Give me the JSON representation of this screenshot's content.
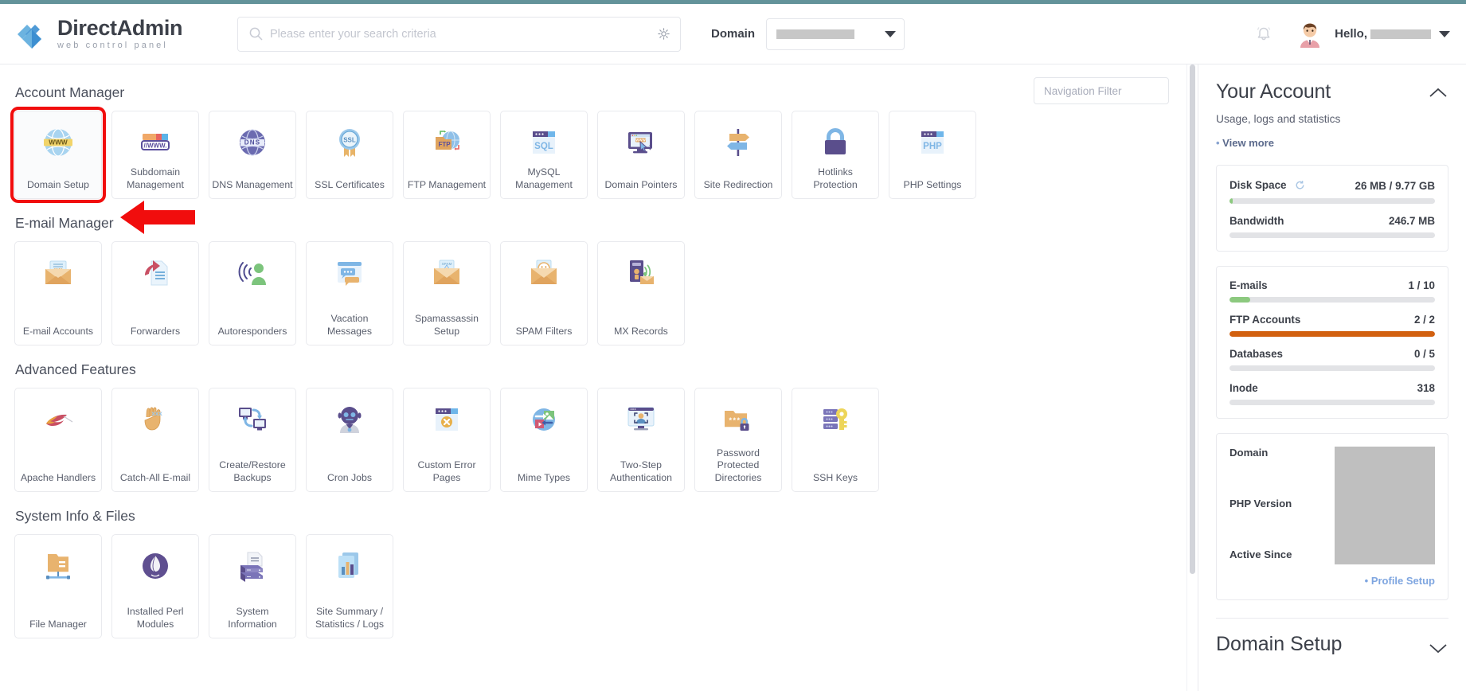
{
  "brand": {
    "name_primary": "Direct",
    "name_secondary": "Admin",
    "tagline": "web control panel"
  },
  "header": {
    "search_placeholder": "Please enter your search criteria",
    "search_value": "",
    "search_icon": "search-icon",
    "settings_icon": "gear-icon",
    "domain_label": "Domain",
    "domain_value": "",
    "bell_icon": "bell-icon",
    "avatar_icon": "user-avatar",
    "hello_label": "Hello,",
    "user_value": ""
  },
  "nav_filter": {
    "placeholder": "Navigation Filter",
    "value": ""
  },
  "sections": [
    {
      "title": "Account Manager",
      "tiles": [
        {
          "label": "Domain Setup",
          "icon": "globe-www-icon",
          "highlighted": true
        },
        {
          "label": "Subdomain Management",
          "icon": "subdomain-browser-icon",
          "highlighted": false
        },
        {
          "label": "DNS Management",
          "icon": "dns-globe-icon",
          "highlighted": false
        },
        {
          "label": "SSL Certificates",
          "icon": "ssl-badge-icon",
          "highlighted": false
        },
        {
          "label": "FTP Management",
          "icon": "ftp-folder-icon",
          "highlighted": false
        },
        {
          "label": "MySQL Management",
          "icon": "sql-window-icon",
          "highlighted": false
        },
        {
          "label": "Domain Pointers",
          "icon": "monitor-www-icon",
          "highlighted": false
        },
        {
          "label": "Site Redirection",
          "icon": "signpost-icon",
          "highlighted": false
        },
        {
          "label": "Hotlinks Protection",
          "icon": "padlock-icon",
          "highlighted": false
        },
        {
          "label": "PHP Settings",
          "icon": "php-window-icon",
          "highlighted": false
        }
      ]
    },
    {
      "title": "E-mail Manager",
      "tiles": [
        {
          "label": "E-mail Accounts",
          "icon": "envelope-password-icon",
          "highlighted": false
        },
        {
          "label": "Forwarders",
          "icon": "forward-arrow-doc-icon",
          "highlighted": false
        },
        {
          "label": "Autoresponders",
          "icon": "person-broadcast-icon",
          "highlighted": false
        },
        {
          "label": "Vacation Messages",
          "icon": "chat-window-icon",
          "highlighted": false
        },
        {
          "label": "Spamassassin Setup",
          "icon": "spam-envelope-icon",
          "highlighted": false
        },
        {
          "label": "SPAM Filters",
          "icon": "smiley-envelope-icon",
          "highlighted": false
        },
        {
          "label": "MX Records",
          "icon": "server-mail-icon",
          "highlighted": false
        }
      ]
    },
    {
      "title": "Advanced Features",
      "tiles": [
        {
          "label": "Apache Handlers",
          "icon": "feather-icon",
          "highlighted": false
        },
        {
          "label": "Catch-All E-mail",
          "icon": "catch-hand-icon",
          "highlighted": false
        },
        {
          "label": "Create/Restore Backups",
          "icon": "two-monitors-sync-icon",
          "highlighted": false
        },
        {
          "label": "Cron Jobs",
          "icon": "robot-icon",
          "highlighted": false
        },
        {
          "label": "Custom Error Pages",
          "icon": "error-window-icon",
          "highlighted": false
        },
        {
          "label": "Mime Types",
          "icon": "mime-circle-icon",
          "highlighted": false
        },
        {
          "label": "Two-Step Authentication",
          "icon": "monitor-face-scan-icon",
          "highlighted": false
        },
        {
          "label": "Password Protected Directories",
          "icon": "folder-lock-icon",
          "highlighted": false
        },
        {
          "label": "SSH Keys",
          "icon": "server-key-icon",
          "highlighted": false
        }
      ]
    },
    {
      "title": "System Info & Files",
      "tiles": [
        {
          "label": "File Manager",
          "icon": "folder-network-icon",
          "highlighted": false
        },
        {
          "label": "Installed Perl Modules",
          "icon": "perl-onion-icon",
          "highlighted": false
        },
        {
          "label": "System Information",
          "icon": "server-doc-icon",
          "highlighted": false
        },
        {
          "label": "Site Summary / Statistics / Logs",
          "icon": "stats-chart-icon",
          "highlighted": false
        }
      ]
    }
  ],
  "sidebar": {
    "title": "Your Account",
    "subtitle": "Usage, logs and statistics",
    "view_more": "View more",
    "collapse_icon": "chevron-up-icon",
    "usage_primary": [
      {
        "name": "Disk Space",
        "value": "26 MB / 9.77 GB",
        "percent": 1,
        "color": "#8cc97f",
        "has_refresh": true
      },
      {
        "name": "Bandwidth",
        "value": "246.7 MB",
        "percent": 0,
        "color": "#8cc97f",
        "has_refresh": false
      }
    ],
    "usage_secondary": [
      {
        "name": "E-mails",
        "value": "1 / 10",
        "percent": 10,
        "color": "#8cc97f"
      },
      {
        "name": "FTP Accounts",
        "value": "2 / 2",
        "percent": 100,
        "color": "#d2600f"
      },
      {
        "name": "Databases",
        "value": "0 / 5",
        "percent": 0,
        "color": "#8cc97f"
      },
      {
        "name": "Inode",
        "value": "318",
        "percent": 0,
        "color": "#8cc97f"
      }
    ],
    "domain_info": {
      "labels": [
        "Domain",
        "PHP Version",
        "Active Since"
      ],
      "values_redacted": true,
      "profile_link": "Profile Setup"
    },
    "second_title": "Domain Setup",
    "second_icon": "chevron-down-icon"
  },
  "annotation": {
    "arrow_color": "#f10d0d",
    "highlight_color": "#f10d0d",
    "target": "Domain Setup"
  }
}
